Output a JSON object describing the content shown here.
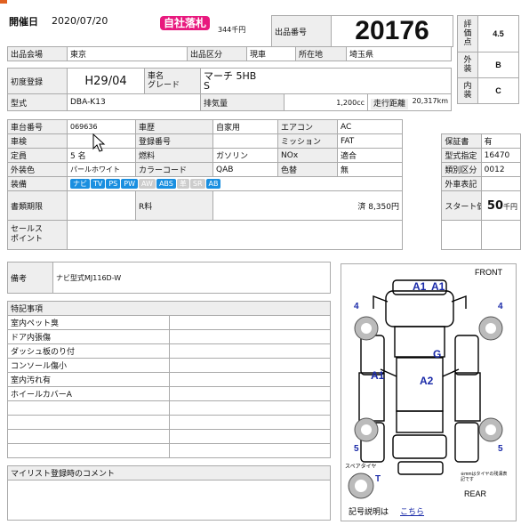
{
  "header": {
    "date_label": "開催日",
    "date": "2020/07/20",
    "badge": "自社落札",
    "price": "344千円",
    "lot_label": "出品番号",
    "lot_number": "20176"
  },
  "scores": {
    "overall_label": "評価点",
    "overall": "4.5",
    "exterior_label": "外装",
    "exterior": "B",
    "interior_label": "内装",
    "interior": "C"
  },
  "venue": {
    "venue_label": "出品会場",
    "venue": "東京",
    "category_label": "出品区分",
    "category": "現車",
    "location_label": "所在地",
    "location": "埼玉県"
  },
  "car": {
    "reg_label": "初度登録",
    "reg": "H29/04",
    "name_label": "車名\nグレード",
    "name": "マーチ 5HB\nS",
    "model_label": "型式",
    "model": "DBA-K13",
    "disp_label": "排気量",
    "disp": "1,200cc",
    "mileage_label": "走行距離",
    "mileage": "20,317km"
  },
  "specs": {
    "chassis_label": "車台番号",
    "chassis": "069636",
    "history_label": "車歴",
    "history": "自家用",
    "ac_label": "エアコン",
    "ac": "AC",
    "shaken_label": "車検",
    "shaken": "",
    "regno_label": "登録番号",
    "regno": "",
    "mission_label": "ミッション",
    "mission": "FAT",
    "warranty_label": "保証書",
    "warranty": "有",
    "seats_label": "定員",
    "seats": "5 名",
    "fuel_label": "燃料",
    "fuel": "ガソリン",
    "nox_label": "NOx",
    "nox": "適合",
    "typeno_label": "型式指定",
    "typeno": "16470",
    "color_label": "外装色",
    "color": "パールホワイト",
    "colorcode_label": "カラーコード",
    "colorcode": "QAB",
    "recolor_label": "色替",
    "recolor": "無",
    "class_label": "類別区分",
    "class": "0012",
    "equip_label": "装備",
    "equipment": [
      "ナビ",
      "TV",
      "PS",
      "PW",
      "AW",
      "ABS",
      "革",
      "SR",
      "AB"
    ],
    "equip_on": [
      true,
      true,
      true,
      true,
      false,
      true,
      false,
      false,
      true
    ],
    "ext_label": "外車表記",
    "ext": "",
    "docs_label": "書類期限",
    "docs": "",
    "r_label": "R料",
    "r_value": "済 8,350円",
    "start_label": "スタート価格",
    "start": "50",
    "start_unit": "千円",
    "sales_label": "セールス\nポイント"
  },
  "notes": {
    "biko_label": "備考",
    "biko": "ナビ型式MJ116D-W",
    "special_label": "特記事項",
    "items": [
      "室内ペット臭",
      "ドア内張傷",
      "ダッシュ板のり付",
      "コンソール傷小",
      "室内汚れ有",
      "ホイールカバーA",
      "",
      "",
      "",
      ""
    ],
    "comment_label": "マイリスト登録時のコメント"
  },
  "diagram": {
    "front": "FRONT",
    "rear": "REAR",
    "marks": [
      "A1",
      "A1",
      "A1",
      "A2",
      "G"
    ],
    "tire_fl": "4",
    "tire_fr": "4",
    "tire_rl": "5",
    "tire_rr": "5",
    "spare": "T",
    "spare_label": "スペアタイヤ",
    "spare_note": "※mmはタイヤの残溝表記です",
    "legend_label": "記号説明は",
    "legend_link": "こちら"
  }
}
